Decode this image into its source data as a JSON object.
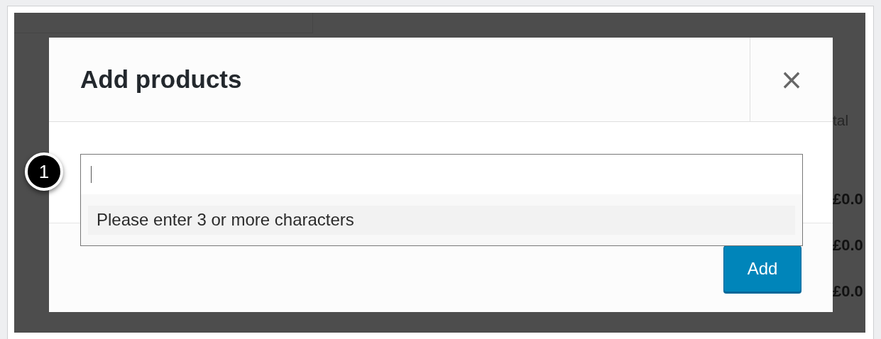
{
  "background": {
    "column_header": "tal",
    "values": [
      "£0.0",
      "£0.0",
      "£0.0"
    ]
  },
  "modal": {
    "title": "Add products",
    "close_label": "×",
    "search": {
      "message": "Please enter 3 or more characters"
    },
    "buttons": [
      {
        "label": "Add",
        "kind": "primary"
      }
    ]
  },
  "callout": {
    "number": "1"
  }
}
